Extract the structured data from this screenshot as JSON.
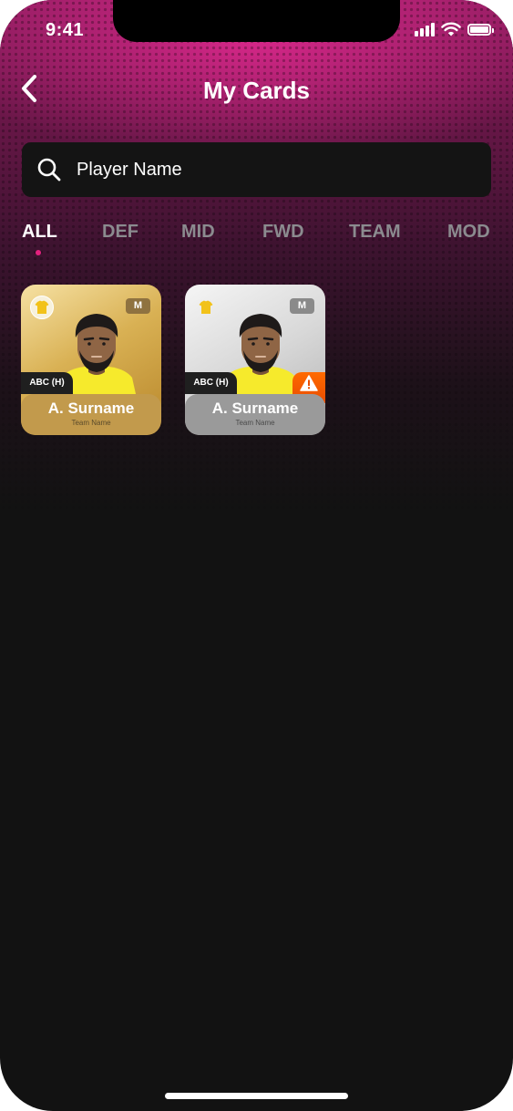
{
  "status_bar": {
    "time": "9:41"
  },
  "header": {
    "title": "My Cards"
  },
  "search": {
    "placeholder": "Player Name"
  },
  "tabs": [
    {
      "label": "ALL",
      "active": true
    },
    {
      "label": "DEF"
    },
    {
      "label": "MID"
    },
    {
      "label": "FWD"
    },
    {
      "label": "TEAM"
    },
    {
      "label": "MOD"
    }
  ],
  "cards": [
    {
      "variant": "gold",
      "position": "M",
      "fixture": "ABC (H)",
      "player_name": "A. Surname",
      "team_name": "Team Name",
      "warning": false
    },
    {
      "variant": "silver",
      "position": "M",
      "fixture": "ABC (H)",
      "player_name": "A. Surname",
      "team_name": "Team Name",
      "warning": true
    }
  ],
  "colors": {
    "accent": "#e3217e",
    "gold": "#c29a4c",
    "silver": "#9a9a9a",
    "warning": "#ff6a00"
  }
}
